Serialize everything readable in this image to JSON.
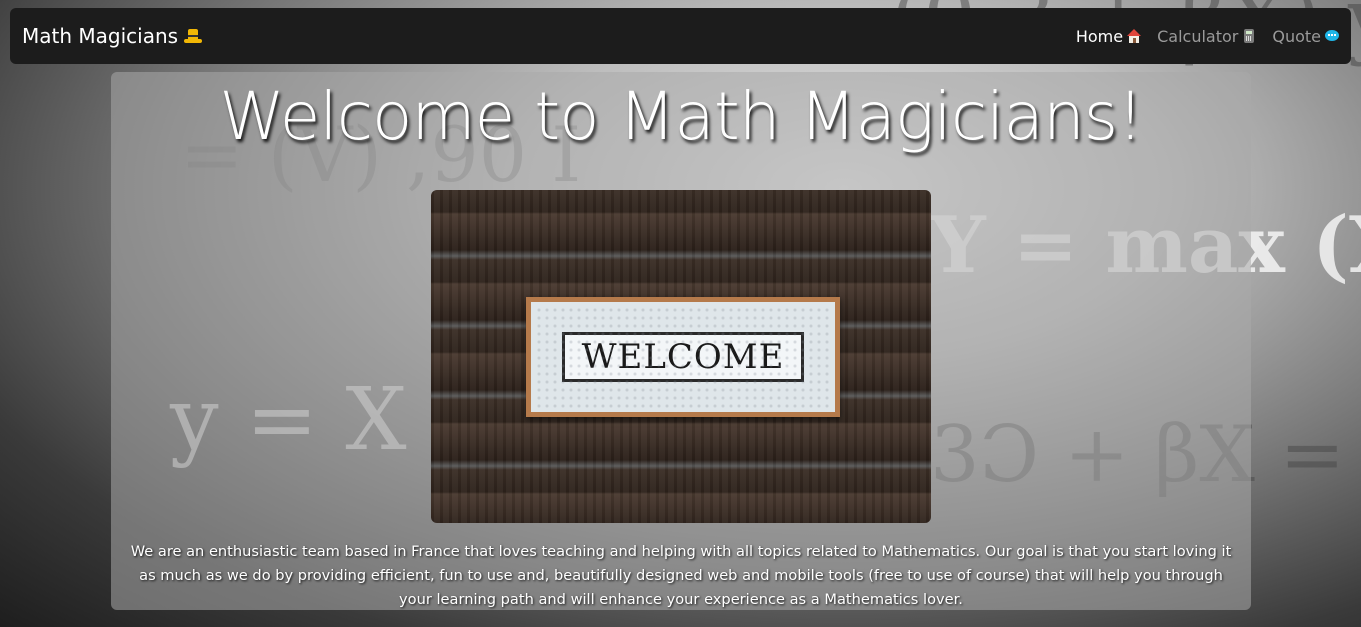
{
  "navbar": {
    "brand": "Math Magicians",
    "brand_icon": "magic-hat-icon",
    "links": [
      {
        "label": "Home",
        "icon": "house-icon",
        "active": true
      },
      {
        "label": "Calculator",
        "icon": "calculator-icon",
        "active": false
      },
      {
        "label": "Quote",
        "icon": "speech-bubble-icon",
        "active": false
      }
    ]
  },
  "main": {
    "title": "Welcome to Math Magicians!",
    "hero_sign_text": "WELCOME",
    "description": "We are an enthusiastic team based in France that loves teaching and helping with all topics related to Mathematics. Our goal is that you start loving it as much as we do by providing efficient, fun to use and, beautifully designed web and mobile tools (free to use of course) that will help you through your learning path and will enhance your experience as a Mathematics lover."
  },
  "colors": {
    "navbar_bg": "#1c1c1c",
    "active_link": "#ffffff",
    "inactive_link": "#9a9a9a"
  }
}
